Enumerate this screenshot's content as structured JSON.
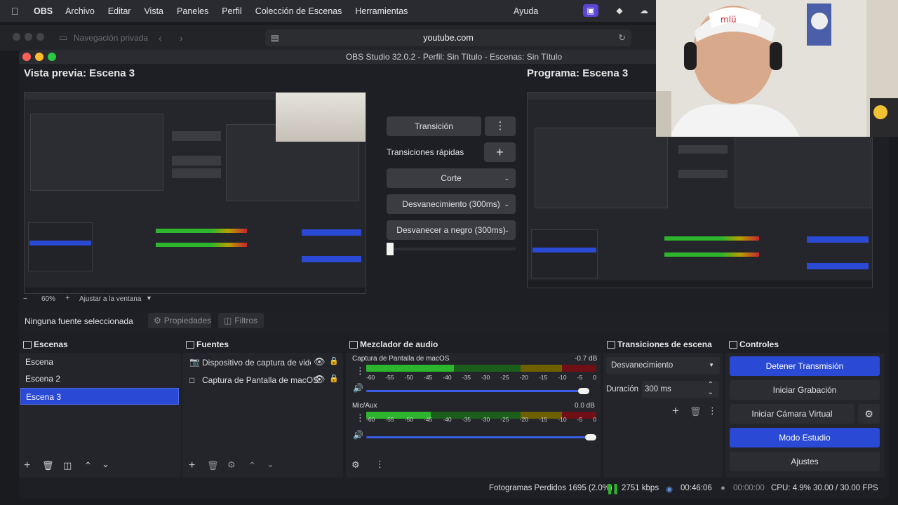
{
  "menubar": {
    "app": "OBS",
    "items": [
      "Archivo",
      "Editar",
      "Vista",
      "Paneles",
      "Perfil",
      "Colección de Escenas",
      "Herramientas"
    ],
    "help": "Ayuda"
  },
  "browser": {
    "private_label": "Navegación privada",
    "url": "youtube.com"
  },
  "window": {
    "title": "OBS Studio 32.0.2 - Perfil: Sin Título - Escenas: Sin Título"
  },
  "preview": {
    "header": "Vista previa: Escena 3",
    "zoom": "60%",
    "fit": "Ajustar a la ventana"
  },
  "program": {
    "header": "Programa: Escena 3"
  },
  "transitions_center": {
    "transition_button": "Transición",
    "quick_label": "Transiciones rápidas",
    "cut": "Corte",
    "fade": "Desvanecimiento (300ms)",
    "fade_black": "Desvanecer a negro (300ms)"
  },
  "source_bar": {
    "no_source": "Ninguna fuente seleccionada",
    "properties": "Propiedades",
    "filters": "Filtros"
  },
  "scenes": {
    "title": "Escenas",
    "items": [
      "Escena",
      "Escena 2",
      "Escena 3"
    ],
    "selected": 2
  },
  "sources": {
    "title": "Fuentes",
    "items": [
      {
        "label": "Dispositivo de captura de video (",
        "icon": "camera-icon"
      },
      {
        "label": "Captura de Pantalla de macOS",
        "icon": "monitor-icon"
      }
    ]
  },
  "mixer": {
    "title": "Mezclador de audio",
    "channels": [
      {
        "name": "Captura de Pantalla de macOS",
        "db": "-0.7 dB",
        "level": 0.38,
        "volume": 0.97
      },
      {
        "name": "Mic/Aux",
        "db": "0.0 dB",
        "level": 0.28,
        "volume": 1.0
      }
    ],
    "ticks": [
      "-60",
      "-55",
      "-50",
      "-45",
      "-40",
      "-35",
      "-30",
      "-25",
      "-20",
      "-15",
      "-10",
      "-5",
      "0"
    ]
  },
  "scene_transitions": {
    "title": "Transiciones de escena",
    "selected": "Desvanecimiento",
    "duration_label": "Duración",
    "duration_value": "300 ms"
  },
  "controls": {
    "title": "Controles",
    "stop_stream": "Detener Transmisión",
    "start_recording": "Iniciar Grabación",
    "start_virtual_cam": "Iniciar Cámara Virtual",
    "studio_mode": "Modo Estudio",
    "settings": "Ajustes"
  },
  "status": {
    "dropped": "Fotogramas Perdidos 1695 (2.0%)",
    "kbps": "2751 kbps",
    "stream_time": "00:46:06",
    "rec_time": "00:00:00",
    "cpu": "CPU: 4.9%",
    "fps": "30.00 / 30.00 FPS"
  },
  "colors": {
    "accent": "#2a49d4",
    "meter_green": "#2db52d",
    "meter_yellow": "#b8a000",
    "meter_red": "#c8262e"
  }
}
